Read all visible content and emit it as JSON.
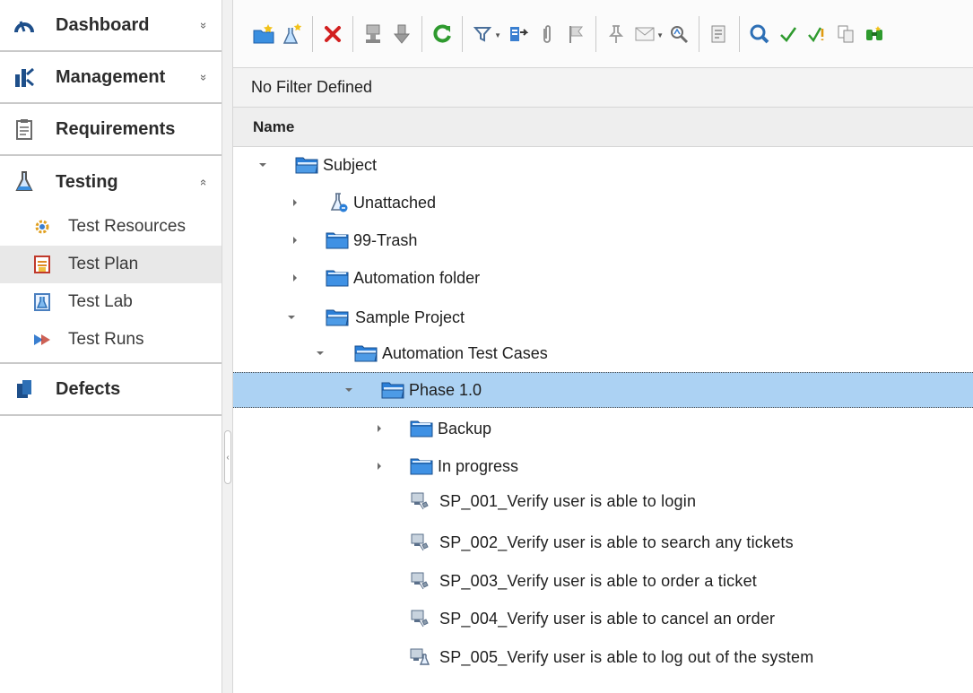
{
  "sidebar": {
    "sections": [
      {
        "label": "Dashboard",
        "icon": "dashboard-icon",
        "chevron": "»"
      },
      {
        "label": "Management",
        "icon": "management-icon",
        "chevron": "»"
      },
      {
        "label": "Requirements",
        "icon": "requirements-icon",
        "chevron": ""
      },
      {
        "label": "Testing",
        "icon": "testing-icon",
        "chevron": "«"
      }
    ],
    "testing_items": [
      {
        "label": "Test Resources",
        "icon": "test-resources-icon"
      },
      {
        "label": "Test Plan",
        "icon": "test-plan-icon",
        "active": true
      },
      {
        "label": "Test Lab",
        "icon": "test-lab-icon"
      },
      {
        "label": "Test Runs",
        "icon": "test-runs-icon"
      }
    ],
    "defects": {
      "label": "Defects",
      "icon": "defects-icon"
    }
  },
  "toolbar": {
    "buttons": [
      "new-folder-icon",
      "new-test-icon",
      "delete-icon",
      "copy-to-icon",
      "download-icon",
      "refresh-icon",
      "filter-icon",
      "export-icon",
      "attachments-icon",
      "flag-icon",
      "pin-icon",
      "email-icon",
      "find-icon",
      "text-search-icon",
      "select-columns-icon",
      "check-icon",
      "check-warning-icon",
      "compare-icon",
      "binoculars-icon"
    ]
  },
  "filter": {
    "text": "No Filter Defined"
  },
  "grid": {
    "column_name": "Name"
  },
  "tree": {
    "subject": "Subject",
    "unattached": "Unattached",
    "trash": "99-Trash",
    "automation_folder": "Automation folder",
    "sample_project": "Sample Project",
    "automation_test_cases": "Automation Test Cases",
    "phase": "Phase 1.0",
    "backup": "Backup",
    "in_progress": "In progress",
    "tests": [
      "SP_001_Verify user is able to login",
      "SP_002_Verify user is able to search any tickets",
      "SP_003_Verify user is able to order a ticket",
      "SP_004_Verify user is able to cancel an order",
      "SP_005_Verify user is able to log out of the system"
    ]
  },
  "colors": {
    "selection": "#acd2f3",
    "folder_blue": "#2b7fd8",
    "delete_red": "#d22020",
    "refresh_green": "#2e9a2e"
  }
}
